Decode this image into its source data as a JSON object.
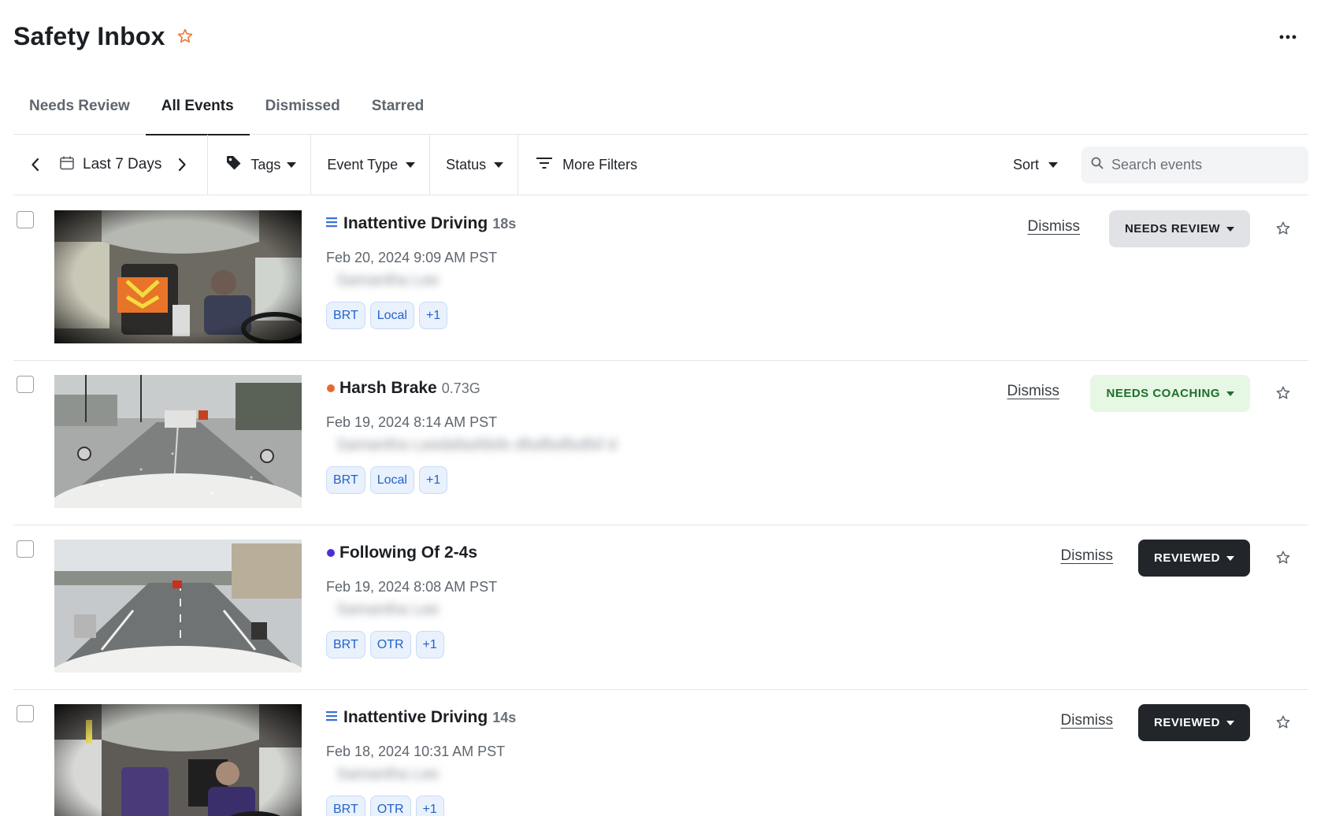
{
  "header": {
    "title": "Safety Inbox",
    "more_icon": "more-horizontal-icon",
    "star_color": "#e8793a"
  },
  "tabs": [
    {
      "label": "Needs Review",
      "active": false
    },
    {
      "label": "All Events",
      "active": true
    },
    {
      "label": "Dismissed",
      "active": false
    },
    {
      "label": "Starred",
      "active": false
    }
  ],
  "filters": {
    "date_range": "Last 7 Days",
    "tags": "Tags",
    "event_type": "Event Type",
    "status": "Status",
    "more_filters": "More Filters",
    "sort": "Sort",
    "search_placeholder": "Search events"
  },
  "dismiss_label": "Dismiss",
  "events": [
    {
      "title": "Inattentive Driving",
      "meta": "18s",
      "indicator": "list-icon",
      "indicator_color": "#3b6fd9",
      "date": "Feb 20, 2024 9:09 AM PST",
      "driver": "Samantha Lee",
      "tags": [
        "BRT",
        "Local",
        "+1"
      ],
      "status": "NEEDS REVIEW",
      "thumbnail": "inward-cab-camera"
    },
    {
      "title": "Harsh Brake",
      "meta": "0.73G",
      "indicator": "dot",
      "indicator_color": "#e8692e",
      "date": "Feb 19, 2024 8:14 AM PST",
      "driver": "Samantha Leedafasfdsfs dfsdfsdfsdfsf d",
      "tags": [
        "BRT",
        "Local",
        "+1"
      ],
      "status": "NEEDS COACHING",
      "thumbnail": "road-camera-rain"
    },
    {
      "title": "Following Of 2-4s",
      "meta": "",
      "indicator": "dot",
      "indicator_color": "#4b2fd6",
      "date": "Feb 19, 2024 8:08 AM PST",
      "driver": "Samantha Lee",
      "tags": [
        "BRT",
        "OTR",
        "+1"
      ],
      "status": "REVIEWED",
      "thumbnail": "road-camera-highway"
    },
    {
      "title": "Inattentive Driving",
      "meta": "14s",
      "indicator": "list-icon",
      "indicator_color": "#3b6fd9",
      "date": "Feb 18, 2024 10:31 AM PST",
      "driver": "Samantha Lee",
      "tags": [
        "BRT",
        "OTR",
        "+1"
      ],
      "status": "REVIEWED",
      "thumbnail": "inward-cab-camera"
    }
  ]
}
